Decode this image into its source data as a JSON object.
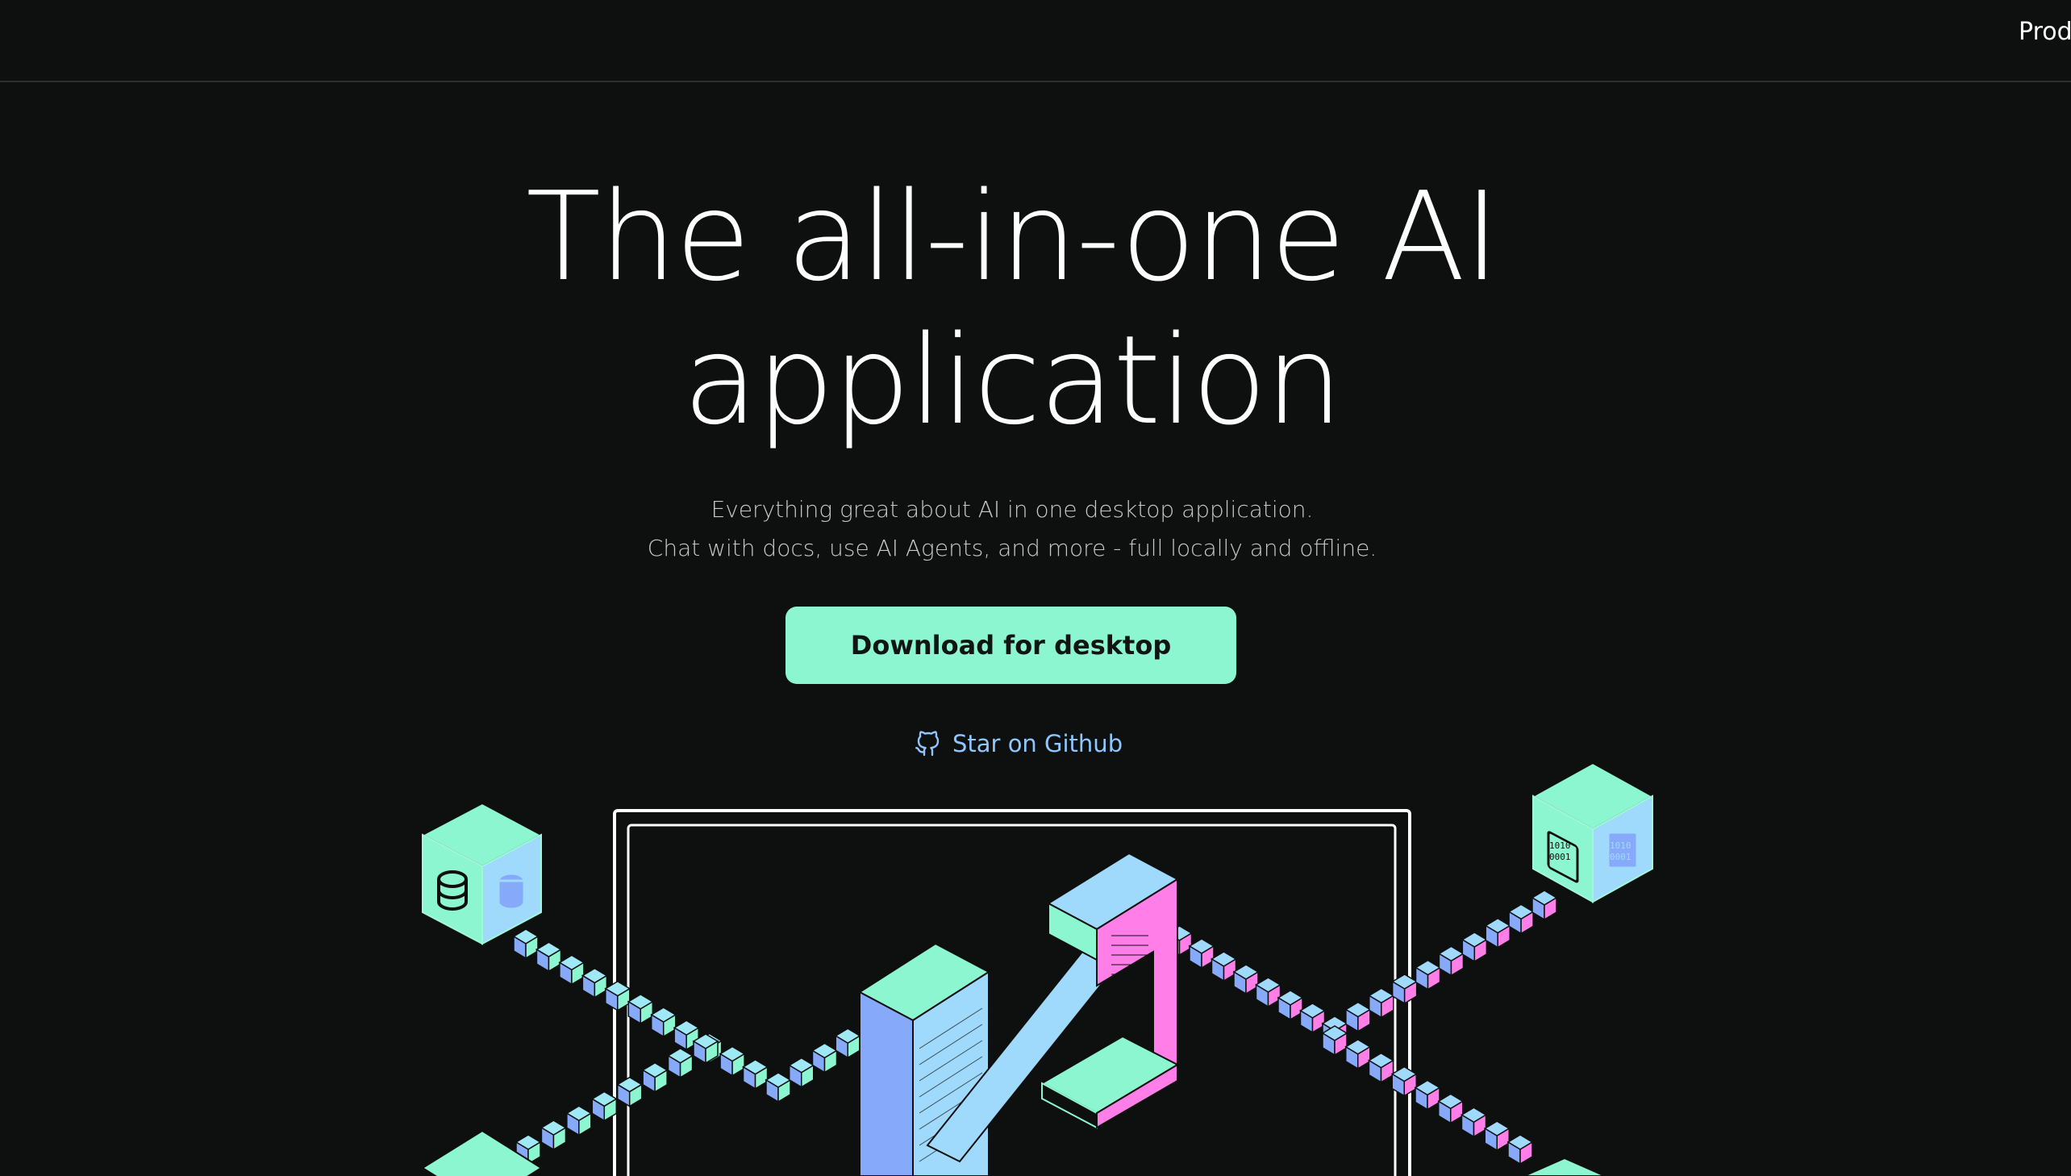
{
  "nav": {
    "items": [
      {
        "label": "Prod"
      }
    ]
  },
  "hero": {
    "title_line1": "The all-in-one AI",
    "title_line2": "application",
    "subtitle_line1": "Everything great about AI in one desktop application.",
    "subtitle_line2": "Chat with docs, use AI Agents, and more - full locally and offline.",
    "cta_label": "Download for desktop",
    "github_label": "Star on Github"
  },
  "illustration": {
    "left_cube_icon": "database-icon",
    "right_cube_icon": "binary-file-icon",
    "right_cube_text_1": "1010",
    "right_cube_text_2": "0001"
  },
  "colors": {
    "background": "#0e100f",
    "accent_mint": "#8cf6d0",
    "accent_blue": "#8ec7ff",
    "accent_pink": "#ff7ee8",
    "cube_side_blue": "#86aaf9",
    "cube_top_light": "#9fe8f6"
  }
}
